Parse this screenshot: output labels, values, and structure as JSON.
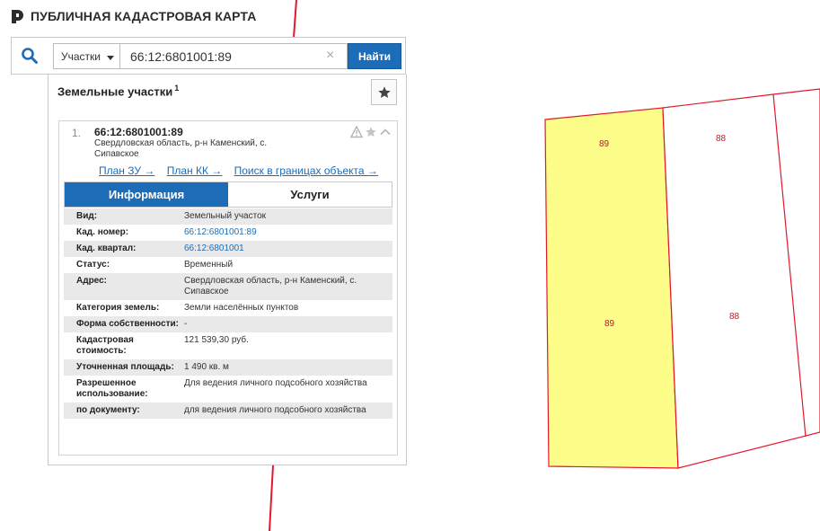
{
  "app": {
    "title": "ПУБЛИЧНАЯ КАДАСТРОВАЯ КАРТА"
  },
  "search": {
    "type_label": "Участки",
    "value": "66:12:6801001:89",
    "find_label": "Найти",
    "clear_symbol": "×"
  },
  "panel": {
    "title": "Земельные участки",
    "count": "1"
  },
  "result": {
    "number": "1.",
    "cad_number": "66:12:6801001:89",
    "address": "Свердловская область, р-н Каменский, с. Сипавское",
    "links": [
      "План ЗУ →",
      "План КК →",
      "Поиск в границах объекта →"
    ],
    "tabs": [
      "Информация",
      "Услуги"
    ],
    "rows": [
      {
        "key": "Вид:",
        "value": "Земельный участок"
      },
      {
        "key": "Кад. номер:",
        "value": "66:12:6801001:89"
      },
      {
        "key": "Кад. квартал:",
        "value": "66:12:6801001"
      },
      {
        "key": "Статус:",
        "value": "Временный"
      },
      {
        "key": "Адрес:",
        "value": "Свердловская область, р-н Каменский, с. Сипавское"
      },
      {
        "key": "Категория земель:",
        "value": "Земли населённых пунктов"
      },
      {
        "key": "Форма собственности:",
        "value": "-"
      },
      {
        "key": "Кадастровая стоимость:",
        "value": "121 539,30 руб."
      },
      {
        "key": "Уточненная площадь:",
        "value": "1 490 кв. м"
      },
      {
        "key": "Разрешенное использование:",
        "value": "Для ведения личного подсобного хозяйства"
      },
      {
        "key": "по документу:",
        "value": "для ведения личного подсобного хозяйства"
      }
    ]
  },
  "map": {
    "labels": [
      "89",
      "89",
      "88",
      "88"
    ],
    "colors": {
      "boundary": "#e2182b",
      "selected_fill": "#fdfd8a",
      "accent": "#1c6cb8"
    }
  }
}
